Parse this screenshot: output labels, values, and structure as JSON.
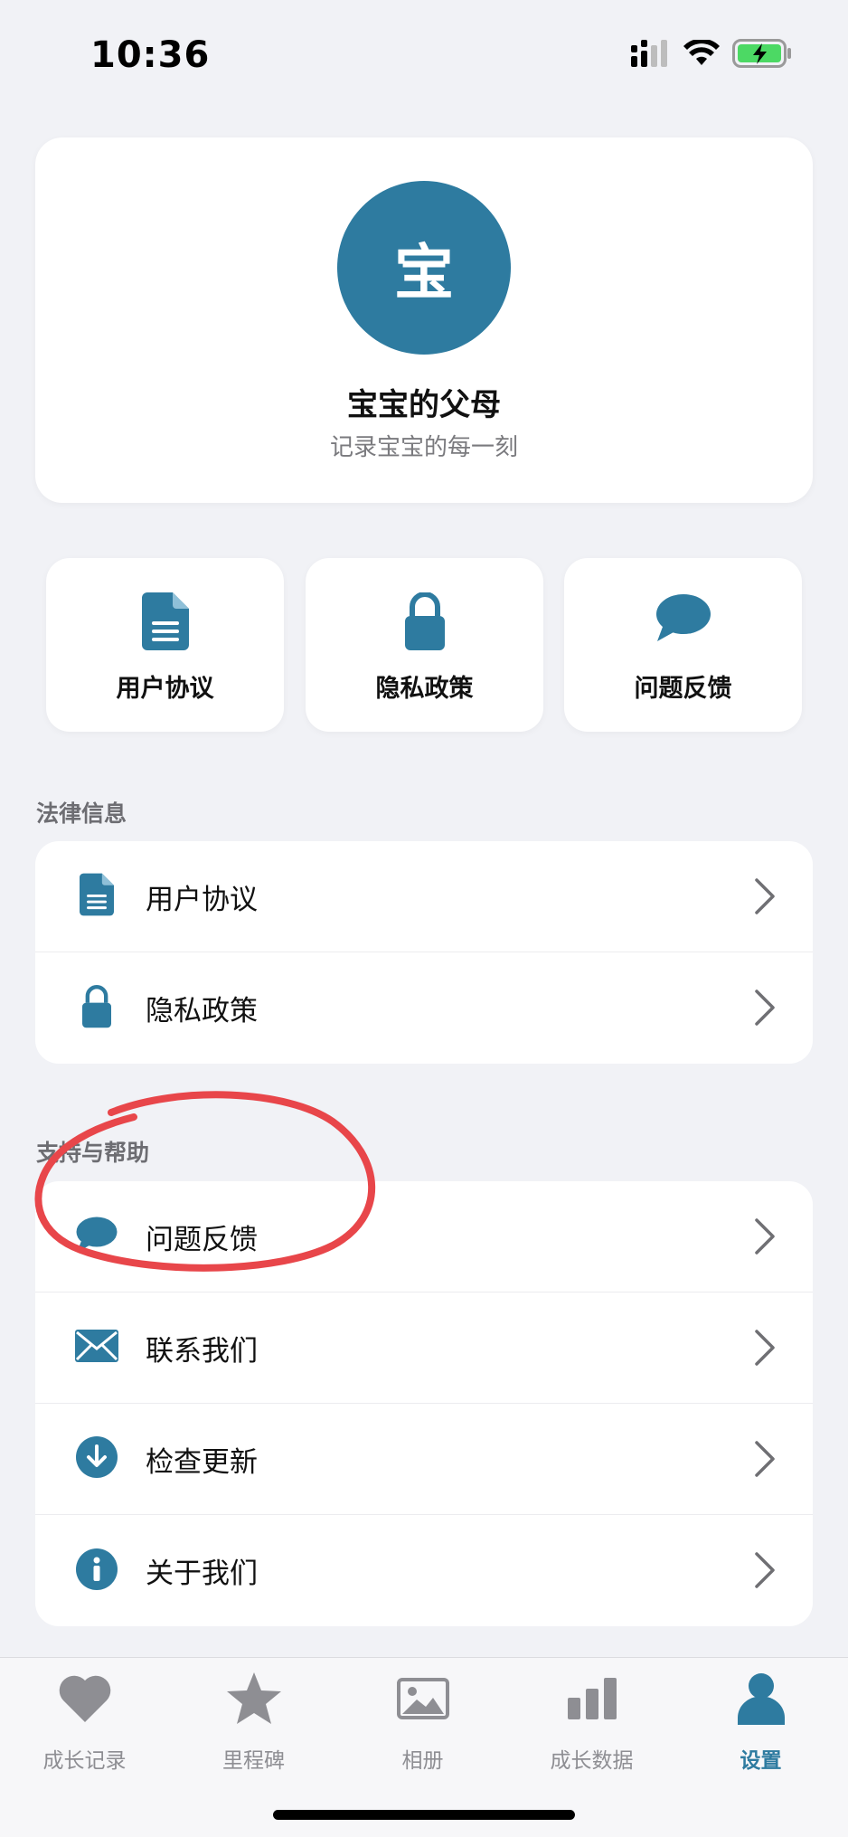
{
  "status_bar": {
    "time": "10:36",
    "signal_icon": "cellular-signal-icon",
    "wifi_icon": "wifi-icon",
    "battery_icon": "battery-charging-icon",
    "battery_color": "#4cd964"
  },
  "profile": {
    "avatar_text": "宝",
    "name": "宝宝的父母",
    "subtitle": "记录宝宝的每一刻",
    "accent_color": "#2e7ba0"
  },
  "quick_tiles": [
    {
      "label": "用户协议",
      "icon": "document-icon"
    },
    {
      "label": "隐私政策",
      "icon": "lock-icon"
    },
    {
      "label": "问题反馈",
      "icon": "chat-bubble-icon"
    }
  ],
  "sections": {
    "legal": {
      "title": "法律信息",
      "items": [
        {
          "label": "用户协议",
          "icon": "document-icon"
        },
        {
          "label": "隐私政策",
          "icon": "lock-icon"
        }
      ]
    },
    "support": {
      "title": "支持与帮助",
      "items": [
        {
          "label": "问题反馈",
          "icon": "chat-bubble-icon"
        },
        {
          "label": "联系我们",
          "icon": "envelope-icon"
        },
        {
          "label": "检查更新",
          "icon": "download-circle-icon"
        },
        {
          "label": "关于我们",
          "icon": "info-circle-icon"
        }
      ]
    }
  },
  "tab_bar": {
    "tabs": [
      {
        "label": "成长记录",
        "icon": "heart-icon",
        "active": false
      },
      {
        "label": "里程碑",
        "icon": "star-icon",
        "active": false
      },
      {
        "label": "相册",
        "icon": "photo-icon",
        "active": false
      },
      {
        "label": "成长数据",
        "icon": "bar-chart-icon",
        "active": false
      },
      {
        "label": "设置",
        "icon": "person-icon",
        "active": true
      }
    ],
    "active_color": "#2e7ba0",
    "inactive_color": "#8e8e93"
  },
  "annotation": {
    "shape": "hand-drawn red circle",
    "color": "#e8464a"
  }
}
